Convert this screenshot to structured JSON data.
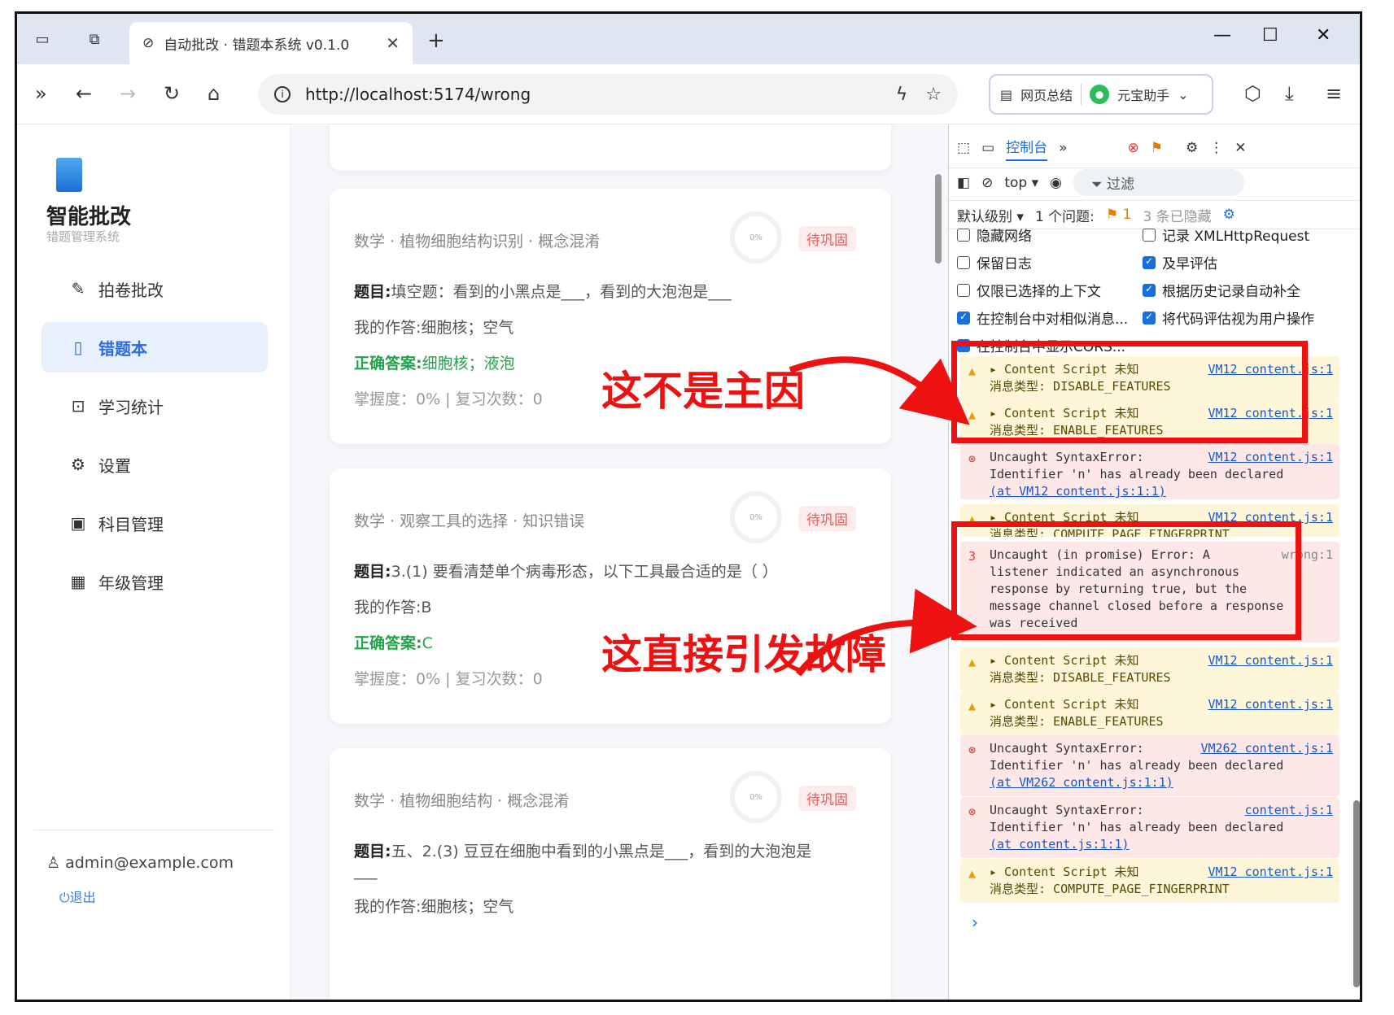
{
  "browser": {
    "tab_title": "自动批改 · 错题本系统 v0.1.0",
    "tab_close": "✕",
    "new_tab": "+",
    "url": "http://localhost:5174/wrong",
    "ext_summary": "网页总结",
    "ext_yuanbao": "元宝助手",
    "ext_chevron": "⌄"
  },
  "sidebar": {
    "brand": "智能批改",
    "brand_sub": "错题管理系统",
    "items": [
      {
        "label": "拍卷批改",
        "icon": "pen-icon"
      },
      {
        "label": "错题本",
        "icon": "notebook-icon"
      },
      {
        "label": "学习统计",
        "icon": "chart-icon"
      },
      {
        "label": "设置",
        "icon": "gear-icon"
      },
      {
        "label": "科目管理",
        "icon": "book-icon"
      },
      {
        "label": "年级管理",
        "icon": "grid-icon"
      }
    ],
    "user": "admin@example.com",
    "logout": "退出"
  },
  "cards": [
    {
      "head": "数学 · 植物细胞结构识别 · 概念混淆",
      "progress": "0%",
      "tag": "待巩固",
      "q_label": "题目:",
      "question": "填空题：看到的小黑点是___，看到的大泡泡是___",
      "my_label": "我的作答:",
      "my_answer": "细胞核；空气",
      "ok_label": "正确答案:",
      "ok_answer": "细胞核；液泡",
      "meta": "掌握度：0%  |  复习次数：0"
    },
    {
      "head": "数学 · 观察工具的选择 · 知识错误",
      "progress": "0%",
      "tag": "待巩固",
      "q_label": "题目:",
      "question": "3.(1) 要看清楚单个病毒形态，以下工具最合适的是（ ）",
      "my_label": "我的作答:",
      "my_answer": "B",
      "ok_label": "正确答案:",
      "ok_answer": "C",
      "meta": "掌握度：0%  |  复习次数：0"
    },
    {
      "head": "数学 · 植物细胞结构 · 概念混淆",
      "progress": "0%",
      "tag": "待巩固",
      "q_label": "题目:",
      "question": "五、2.(3) 豆豆在细胞中看到的小黑点是___，看到的大泡泡是",
      "question_cont": "___",
      "my_label": "我的作答:",
      "my_answer": "细胞核；空气"
    }
  ],
  "devtools": {
    "tab_console": "控制台",
    "context": "top ▾",
    "filter": "过滤",
    "level": "默认级别 ▾",
    "issues": "1 个问题:",
    "issues_count": "1",
    "hidden": "3 条已隐藏",
    "options": [
      {
        "label": "隐藏网络",
        "checked": false
      },
      {
        "label": "记录 XMLHttpRequest",
        "checked": false
      },
      {
        "label": "保留日志",
        "checked": false
      },
      {
        "label": "及早评估",
        "checked": true
      },
      {
        "label": "仅限已选择的上下文",
        "checked": false
      },
      {
        "label": "根据历史记录自动补全",
        "checked": true
      },
      {
        "label": "在控制台中对相似消息...",
        "checked": true
      },
      {
        "label": "将代码评估视为用户操作",
        "checked": true
      },
      {
        "label": "在控制台中显示CORS...",
        "checked": true
      }
    ],
    "logs": [
      {
        "type": "warn",
        "line1": "▸ Content Script 未知",
        "src": "VM12 content.js:1",
        "line2": "消息类型: DISABLE_FEATURES"
      },
      {
        "type": "warn",
        "line1": "▸ Content Script 未知",
        "src": "VM12 content.js:1",
        "line2": "消息类型: ENABLE_FEATURES"
      },
      {
        "type": "err",
        "line1": "Uncaught SyntaxError:",
        "src": "VM12 content.js:1",
        "line2": "Identifier 'n' has already been declared",
        "line3": "(at VM12 content.js:1:1)"
      },
      {
        "type": "warn",
        "line1": "▸ Content Script 未知",
        "src": "VM12 content.js:1",
        "line2": "消息类型: COMPUTE_PAGE_FINGERPRINT"
      },
      {
        "type": "err",
        "count": "3",
        "line1": "Uncaught (in promise) Error: A",
        "src": "wrong:1",
        "line2": "listener indicated an asynchronous",
        "line3": "response by returning true, but the",
        "line4": "message channel closed before a response",
        "line5": "was received"
      },
      {
        "type": "warn",
        "line1": "▸ Content Script 未知",
        "src": "VM12 content.js:1",
        "line2": "消息类型: DISABLE_FEATURES"
      },
      {
        "type": "warn",
        "line1": "▸ Content Script 未知",
        "src": "VM12 content.js:1",
        "line2": "消息类型: ENABLE_FEATURES"
      },
      {
        "type": "err",
        "line1": "Uncaught SyntaxError:",
        "src": "VM262 content.js:1",
        "line2": "Identifier 'n' has already been declared",
        "line3": "(at VM262 content.js:1:1)"
      },
      {
        "type": "err",
        "line1": "Uncaught SyntaxError:",
        "src": "content.js:1",
        "line2": "Identifier 'n' has already been declared",
        "line3": "(at content.js:1:1)"
      },
      {
        "type": "warn",
        "line1": "▸ Content Script 未知",
        "src": "VM12 content.js:1",
        "line2": "消息类型: COMPUTE_PAGE_FINGERPRINT"
      }
    ],
    "prompt": "›"
  },
  "annotations": {
    "note1": "这不是主因",
    "note2": "这直接引发故障",
    "color": "#ee1111"
  }
}
